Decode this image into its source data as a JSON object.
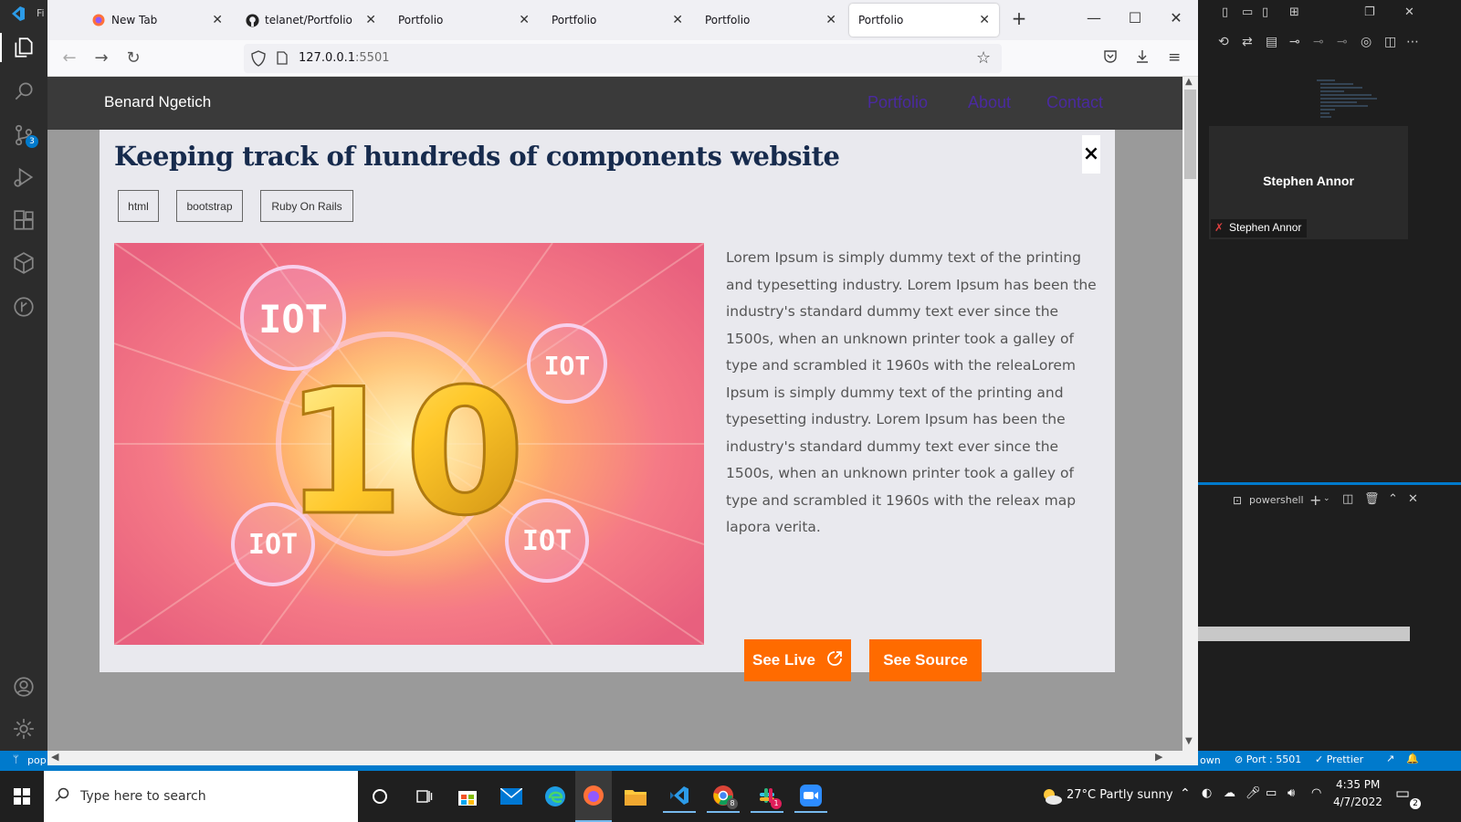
{
  "browser": {
    "tabs": [
      {
        "label": "New Tab",
        "icon": "firefox-icon"
      },
      {
        "label": "telanet/Portfolio",
        "icon": "github-icon"
      },
      {
        "label": "Portfolio",
        "icon": ""
      },
      {
        "label": "Portfolio",
        "icon": ""
      },
      {
        "label": "Portfolio",
        "icon": ""
      },
      {
        "label": "Portfolio",
        "icon": ""
      }
    ],
    "url_host": "127.0.0.1",
    "url_port": ":5501"
  },
  "site": {
    "brand": "Benard Ngetich",
    "nav": [
      "Portfolio",
      "About",
      "Contact"
    ]
  },
  "modal": {
    "title": "Keeping track of hundreds of components website",
    "close": "×",
    "tags": [
      "html",
      "bootstrap",
      "Ruby On Rails"
    ],
    "description": "Lorem Ipsum is simply dummy text of the printing and typesetting industry. Lorem Ipsum has been the industry's standard dummy text ever since the 1500s, when an unknown printer took a galley of type and scrambled it 1960s with the releaLorem Ipsum is simply dummy text of the printing and typesetting industry. Lorem Ipsum has been the industry's standard dummy text ever since the 1500s, when an unknown printer took a galley of type and scrambled it 1960s with the releax map lapora verita.",
    "see_live": "See Live",
    "see_source": "See Source",
    "image_labels": [
      "IOT",
      "IOT",
      "IOT",
      "IOT",
      "10"
    ]
  },
  "vscode": {
    "participant": "Stephen Annor",
    "participant_tag": "Stephen Annor",
    "terminal": "powershell",
    "status_port": "Port : 5501",
    "status_prettier": "Prettier",
    "status_branch": "pop",
    "status_left_fragment": "own",
    "scm_badge": "3",
    "title_fragment": "Fi"
  },
  "taskbar": {
    "search_placeholder": "Type here to search",
    "weather": "27°C  Partly sunny",
    "time": "4:35 PM",
    "date": "4/7/2022",
    "notif_count": "2",
    "chrome_badge": "8",
    "slack_badge": "1"
  },
  "colors": {
    "accent_orange": "#ff6b00",
    "vscode_blue": "#007acc",
    "header_dark": "#3a3a3a",
    "nav_link": "#4a2aa0"
  }
}
